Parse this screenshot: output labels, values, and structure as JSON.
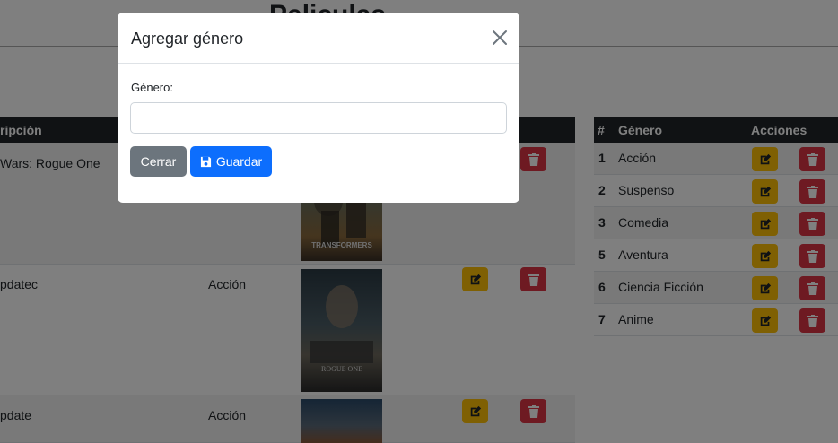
{
  "page": {
    "title": "Peliculas"
  },
  "movies": {
    "header": {
      "descripcion": "ripción"
    },
    "rows": [
      {
        "descripcion": "Wars: Rogue One",
        "genero": "",
        "poster": "transformers-poster"
      },
      {
        "descripcion": "pdatec",
        "genero": "Acción",
        "poster": "rogue-one-poster"
      },
      {
        "descripcion": "pdate",
        "genero": "Acción",
        "poster": "avengers-poster"
      }
    ],
    "poster_texts": {
      "transformers": "TRANSFORMERS",
      "rogue": "ROGUE ONE"
    }
  },
  "genres": {
    "headers": {
      "id": "#",
      "name": "Género",
      "actions": "Acciones"
    },
    "rows": [
      {
        "id": "1",
        "name": "Acción"
      },
      {
        "id": "2",
        "name": "Suspenso"
      },
      {
        "id": "3",
        "name": "Comedia"
      },
      {
        "id": "5",
        "name": "Aventura"
      },
      {
        "id": "6",
        "name": "Ciencia Ficción"
      },
      {
        "id": "7",
        "name": "Anime"
      }
    ]
  },
  "modal": {
    "title": "Agregar género",
    "field_label": "Género:",
    "field_value": "",
    "field_placeholder": "",
    "close_label": "Cerrar",
    "save_label": "Guardar"
  },
  "colors": {
    "primary": "#0d6efd",
    "secondary": "#6c757d",
    "warning": "#ffc107",
    "danger": "#dc3545",
    "dark": "#212529"
  },
  "icons": {
    "edit": "edit-icon",
    "delete": "trash-icon",
    "save": "floppy-disk-icon",
    "close": "close-icon"
  }
}
